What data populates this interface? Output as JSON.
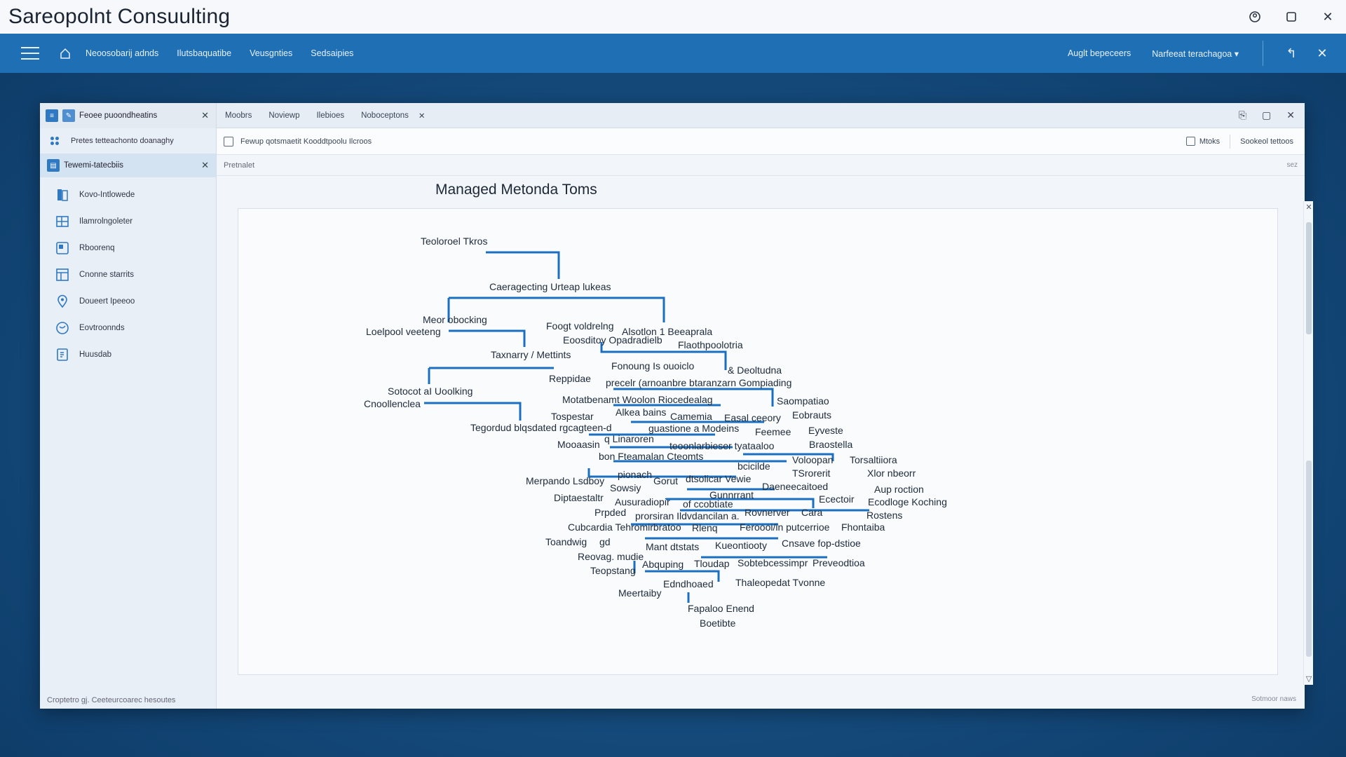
{
  "os": {
    "title": "Sareopolnt Consuulting",
    "controls": [
      "account-icon",
      "maximize-icon",
      "close-icon"
    ]
  },
  "nav": {
    "links": [
      "Neoosobarij adnds",
      "Ilutsbaquatibe",
      "Veusgnties",
      "Sedsaipies"
    ],
    "right_links": [
      "Auglt bepeceers",
      "Narfeeat terachagoa"
    ]
  },
  "sidebar": {
    "top_title": "Feoee puoondheatins",
    "row2_text": "Pretes tetteachonto doanaghy",
    "section_label": "Tewemi-tatecbiis",
    "items": [
      {
        "label": "Kovo-Intlowede",
        "icon": "book-icon"
      },
      {
        "label": "Ilamrolngoleter",
        "icon": "grid-icon"
      },
      {
        "label": "Rboorenq",
        "icon": "image-icon"
      },
      {
        "label": "Cnonne starrits",
        "icon": "table-icon"
      },
      {
        "label": "Doueert Ipeeoo",
        "icon": "location-pin-icon"
      },
      {
        "label": "Eovtroonnds",
        "icon": "globe-icon"
      },
      {
        "label": "Huusdab",
        "icon": "page-icon"
      }
    ],
    "footer": "Croptetro gj.   Ceeteurcoarec hesoutes"
  },
  "tabs": [
    "Moobrs",
    "Noviewp",
    "Ilebioes",
    "Noboceptons"
  ],
  "toolbar": {
    "doc_label": "Fewup qotsmaetit Kooddtpoolu Ilcroos",
    "btn_marks": "Mtoks",
    "btn_socked": "Sookeol tettoos"
  },
  "breadcrumb": "Pretnalet",
  "breadcrumb_right": "sez",
  "status_right": "Sotmoor naws",
  "page_title": "Managed Metonda Toms",
  "tree_nodes": [
    {
      "text": "Teoloroel Tkros"
    },
    {
      "text": "Caeragecting Urteap lukeas"
    },
    {
      "text": "Meor obocking"
    },
    {
      "text": "Loelpool veeteng"
    },
    {
      "text": "Foogt voldrelng"
    },
    {
      "text": "Alsotlon 1 Beeaprala"
    },
    {
      "text": "Eoosditoy Opadradielb"
    },
    {
      "text": "Flaothpoolotria"
    },
    {
      "text": "Taxnarry / Mettints"
    },
    {
      "text": "Fonoung  Is ouoiclo"
    },
    {
      "text": "& Deoltudna"
    },
    {
      "text": "Reppidae"
    },
    {
      "text": "precelr (arnoanbre btaranzarn Gompiading"
    },
    {
      "text": "Sotocot aI Uoolking"
    },
    {
      "text": "Cnoollenclea"
    },
    {
      "text": "Motatbenamt Woolon Riocedealag"
    },
    {
      "text": "Saompatiao"
    },
    {
      "text": "Tospestar"
    },
    {
      "text": "Alkea bains"
    },
    {
      "text": "Camemia"
    },
    {
      "text": "Easal ceeory"
    },
    {
      "text": "Eobrauts"
    },
    {
      "text": "Tegordud blqsdated  rgcagteen-d"
    },
    {
      "text": "guastione a Modeins"
    },
    {
      "text": "Feemee"
    },
    {
      "text": "Eyveste"
    },
    {
      "text": "Mooaasin"
    },
    {
      "text": "q Linaroren"
    },
    {
      "text": "teoonlarbieser tyataaloo"
    },
    {
      "text": "Braostella"
    },
    {
      "text": "bon Fteamalan  Cteomts"
    },
    {
      "text": "Voloopan"
    },
    {
      "text": "Torsaltiiora"
    },
    {
      "text": "bcicilde"
    },
    {
      "text": "TSrorerit"
    },
    {
      "text": "Xlor nbeorr"
    },
    {
      "text": "Merpando Lsdboy"
    },
    {
      "text": "pionach"
    },
    {
      "text": "Gorut"
    },
    {
      "text": "dtsolicar Vewie"
    },
    {
      "text": "Daeneecaitoed"
    },
    {
      "text": "Aup roction"
    },
    {
      "text": "Sowsiy"
    },
    {
      "text": "Gunnrrant"
    },
    {
      "text": "Diptaestaltr"
    },
    {
      "text": "Ausuradiopir"
    },
    {
      "text": "of ccobtiate"
    },
    {
      "text": "Ecectoir"
    },
    {
      "text": "Ecodloge Koching"
    },
    {
      "text": "Prpded"
    },
    {
      "text": "prorsiran Ildvdancilan a."
    },
    {
      "text": "Rovnerver"
    },
    {
      "text": "Cara"
    },
    {
      "text": "Rostens"
    },
    {
      "text": "Cubcardia  Tehromirbratoo"
    },
    {
      "text": "Rlenq"
    },
    {
      "text": "Feroooi/in putcerrioe"
    },
    {
      "text": "Fhontaiba"
    },
    {
      "text": "Toandwig"
    },
    {
      "text": "gd"
    },
    {
      "text": "Mant dtstats"
    },
    {
      "text": "Kueontiooty"
    },
    {
      "text": "Cnsave fop-dstioe"
    },
    {
      "text": "Reovag. mudie"
    },
    {
      "text": "Abquping"
    },
    {
      "text": "Tloudap"
    },
    {
      "text": "Sobtebcessimpr"
    },
    {
      "text": "Preveodtioa"
    },
    {
      "text": "Teopstang"
    },
    {
      "text": "Edndhoaed"
    },
    {
      "text": "Thaleopedat Tvonne"
    },
    {
      "text": "Meertaiby"
    },
    {
      "text": "Fapaloo Enend"
    },
    {
      "text": "Boetibte"
    }
  ]
}
